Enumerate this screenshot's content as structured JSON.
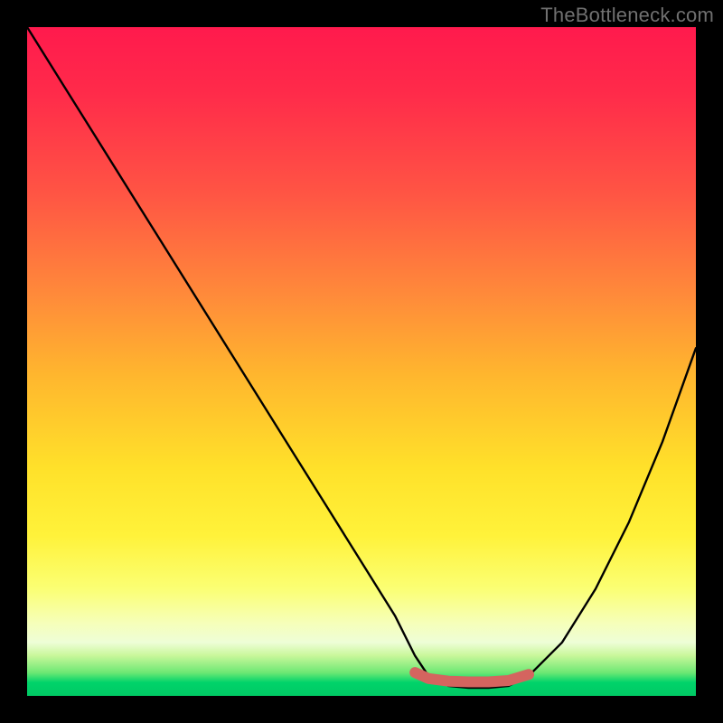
{
  "watermark": "TheBottleneck.com",
  "chart_data": {
    "type": "line",
    "title": "",
    "xlabel": "",
    "ylabel": "",
    "xlim": [
      0,
      100
    ],
    "ylim": [
      0,
      100
    ],
    "grid": false,
    "legend": false,
    "series": [
      {
        "name": "bottleneck-curve",
        "color": "#000000",
        "x": [
          0,
          5,
          10,
          15,
          20,
          25,
          30,
          35,
          40,
          45,
          50,
          55,
          58,
          60,
          63,
          66,
          69,
          72,
          75,
          80,
          85,
          90,
          95,
          100
        ],
        "y": [
          100,
          92,
          84,
          76,
          68,
          60,
          52,
          44,
          36,
          28,
          20,
          12,
          6,
          3,
          1.5,
          1.2,
          1.2,
          1.5,
          3,
          8,
          16,
          26,
          38,
          52
        ]
      },
      {
        "name": "optimal-range-marker",
        "color": "#d4645f",
        "x": [
          58,
          60,
          63,
          66,
          69,
          72,
          75
        ],
        "y": [
          3.5,
          2.6,
          2.2,
          2.1,
          2.1,
          2.3,
          3.2
        ]
      }
    ],
    "background_gradient_stops": [
      {
        "pos": 0,
        "color": "#ff1a4d"
      },
      {
        "pos": 25,
        "color": "#ff5544"
      },
      {
        "pos": 52,
        "color": "#ffb62e"
      },
      {
        "pos": 76,
        "color": "#fff23a"
      },
      {
        "pos": 92,
        "color": "#eefed7"
      },
      {
        "pos": 100,
        "color": "#00c964"
      }
    ]
  }
}
